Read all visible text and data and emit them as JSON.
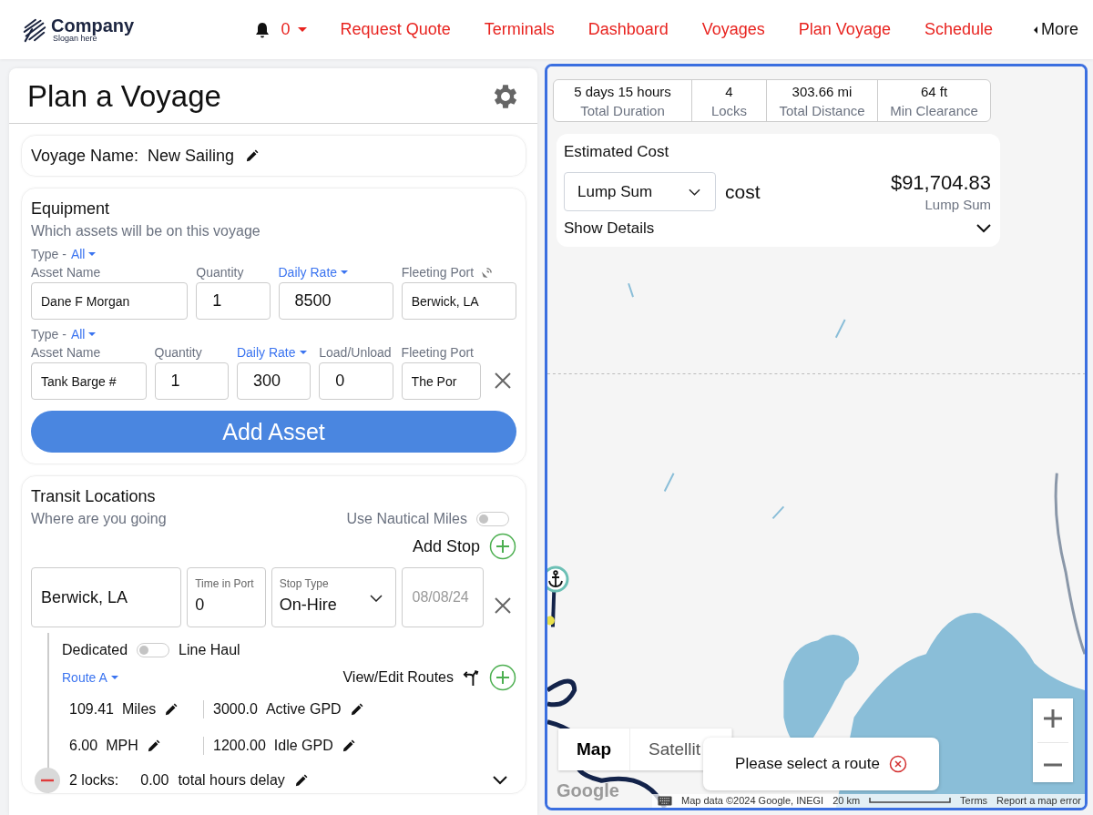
{
  "header": {
    "logo": {
      "name": "Company",
      "slogan": "Slogan here"
    },
    "notifications": {
      "count": "0"
    },
    "nav": [
      {
        "label": "Request Quote"
      },
      {
        "label": "Terminals"
      },
      {
        "label": "Dashboard"
      },
      {
        "label": "Voyages"
      },
      {
        "label": "Plan Voyage"
      },
      {
        "label": "Schedule"
      }
    ],
    "more": "More"
  },
  "planner": {
    "title": "Plan a Voyage",
    "voyage_name": {
      "label": "Voyage Name:",
      "value": "New Sailing"
    },
    "equipment": {
      "title": "Equipment",
      "subtitle": "Which assets will be on this voyage",
      "assets": [
        {
          "type_label": "Type -",
          "type_value": "All",
          "removable": false,
          "fields": [
            {
              "label": "Asset Name",
              "label_menu": false,
              "port_icon": false,
              "kind": "text",
              "value": "Dane F Morgan"
            },
            {
              "label": "Quantity",
              "label_menu": false,
              "port_icon": false,
              "kind": "number",
              "value": "1"
            },
            {
              "label": "Daily Rate",
              "label_menu": true,
              "port_icon": false,
              "kind": "number",
              "value": "8500"
            },
            {
              "label": "Fleeting Port",
              "label_menu": false,
              "port_icon": true,
              "kind": "text",
              "value": "Berwick, LA"
            }
          ]
        },
        {
          "type_label": "Type -",
          "type_value": "All",
          "removable": true,
          "fields": [
            {
              "label": "Asset Name",
              "label_menu": false,
              "port_icon": false,
              "kind": "text",
              "value": "Tank Barge #"
            },
            {
              "label": "Quantity",
              "label_menu": false,
              "port_icon": false,
              "kind": "number",
              "value": "1"
            },
            {
              "label": "Daily Rate",
              "label_menu": true,
              "port_icon": false,
              "kind": "number",
              "value": "300"
            },
            {
              "label": "Load/Unload",
              "label_menu": false,
              "port_icon": false,
              "kind": "number",
              "value": "0"
            },
            {
              "label": "Fleeting Port",
              "label_menu": false,
              "port_icon": false,
              "kind": "text",
              "value": "The Por"
            }
          ]
        }
      ],
      "add_button": "Add Asset"
    },
    "transit": {
      "title": "Transit Locations",
      "subtitle": "Where are you going",
      "nautical": {
        "label": "Use Nautical Miles",
        "on": false
      },
      "add_stop": "Add Stop",
      "stop": {
        "location": "Berwick, LA",
        "time_in_port": {
          "label": "Time in Port",
          "value": "0"
        },
        "stop_type": {
          "label": "Stop Type",
          "value": "On-Hire"
        },
        "date": {
          "placeholder": "08/08/24"
        },
        "removable": true
      },
      "leg": {
        "dedicated": {
          "label": "Dedicated",
          "on": false
        },
        "line_haul": "Line Haul",
        "route": "Route A",
        "view_edit": "View/Edit Routes",
        "metrics": [
          {
            "value": "109.41",
            "unit": "Miles"
          },
          {
            "value": "3000.0",
            "unit": "Active GPD"
          },
          {
            "value": "6.00",
            "unit": "MPH"
          },
          {
            "value": "1200.00",
            "unit": "Idle GPD"
          }
        ],
        "locks": {
          "count": "2 locks:",
          "value": "0.00",
          "label": "total hours delay",
          "expanded": false
        }
      }
    }
  },
  "map": {
    "kind": "picture",
    "stats": [
      {
        "value": "5 days 15 hours",
        "label": "Total Duration"
      },
      {
        "value": "4",
        "label": "Locks"
      },
      {
        "value": "303.66 mi",
        "label": "Total Distance"
      },
      {
        "value": "64 ft",
        "label": "Min Clearance"
      }
    ],
    "cost": {
      "title": "Estimated Cost",
      "basis": "Lump Sum",
      "cost_word": "cost",
      "amount": "$91,704.83",
      "amount_basis": "Lump Sum",
      "details": "Show Details",
      "expanded": false
    },
    "map_types": [
      {
        "label": "Map",
        "selected": true
      },
      {
        "label": "Satellit",
        "selected": false
      }
    ],
    "toast": "Please select a route",
    "logo": "Google",
    "attribution": {
      "data": "Map data ©2024 Google, INEGI",
      "scale": "20 km",
      "terms": "Terms",
      "report": "Report a map error"
    }
  }
}
